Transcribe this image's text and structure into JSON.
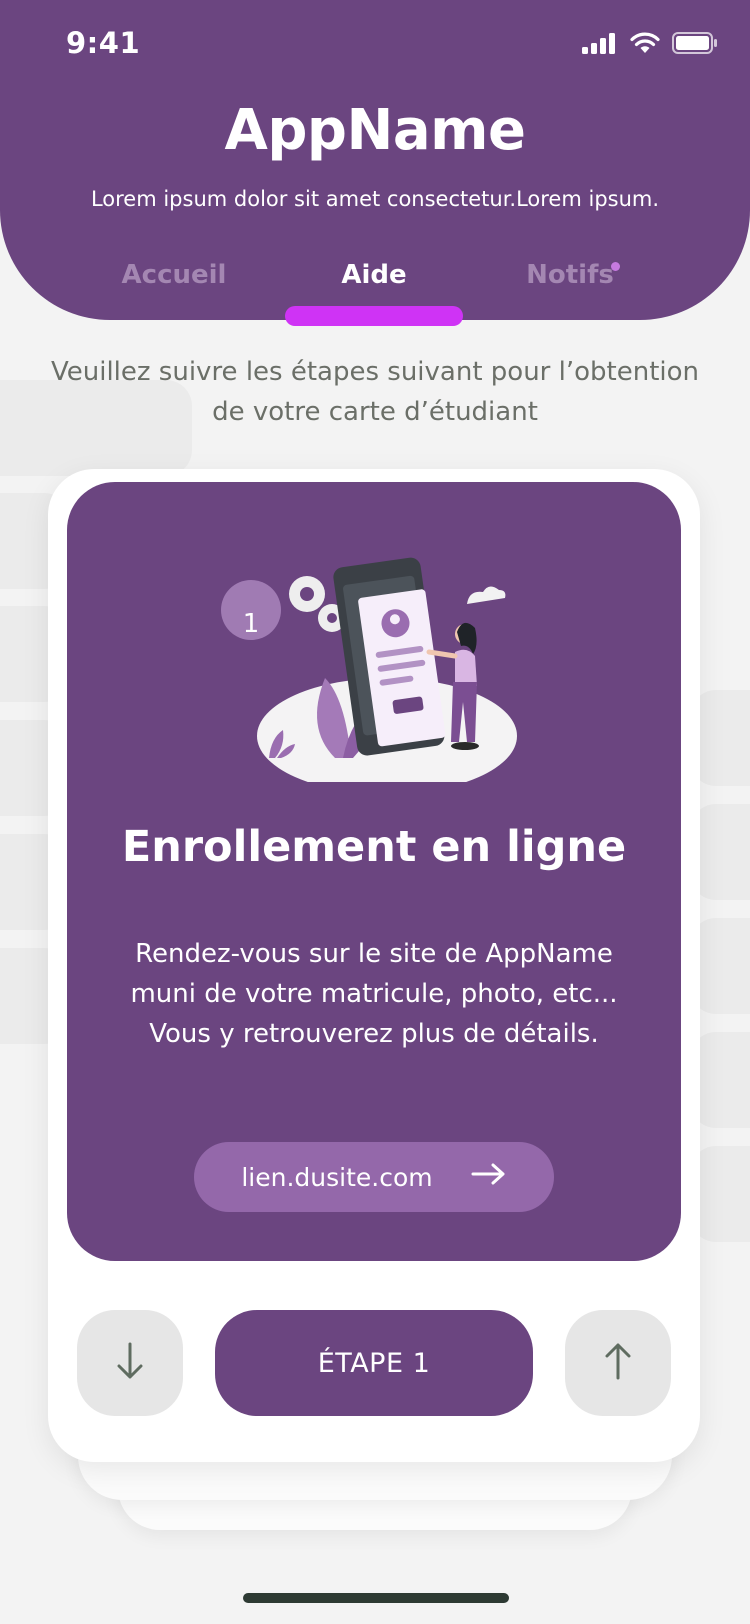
{
  "status_bar": {
    "time": "9:41",
    "icons": [
      "cellular-signal-icon",
      "wifi-icon",
      "battery-icon"
    ]
  },
  "header": {
    "title": "AppName",
    "subtitle": "Lorem ipsum dolor sit amet consectetur.Lorem ipsum.",
    "tabs": [
      {
        "label": "Accueil",
        "active": false
      },
      {
        "label": "Aide",
        "active": true
      },
      {
        "label": "Notifs",
        "active": false,
        "has_dot": true
      }
    ]
  },
  "instructions": "Veuillez suivre les étapes suivant pour l’obtention de votre carte d’étudiant",
  "step_card": {
    "step_number": "1",
    "title": "Enrollement en ligne",
    "description": "Rendez-vous sur le site de AppName muni de votre matricule, photo, etc... Vous y retrouverez plus de détails.",
    "link_label": "lien.dusite.com"
  },
  "controls": {
    "step_label": "ÉTAPE 1",
    "prev_icon": "arrow-down-icon",
    "next_icon": "arrow-up-icon"
  },
  "colors": {
    "primary": "#6b4580",
    "accent": "#cf33f5",
    "link_button": "#9468aa",
    "background": "#f3f3f3"
  }
}
